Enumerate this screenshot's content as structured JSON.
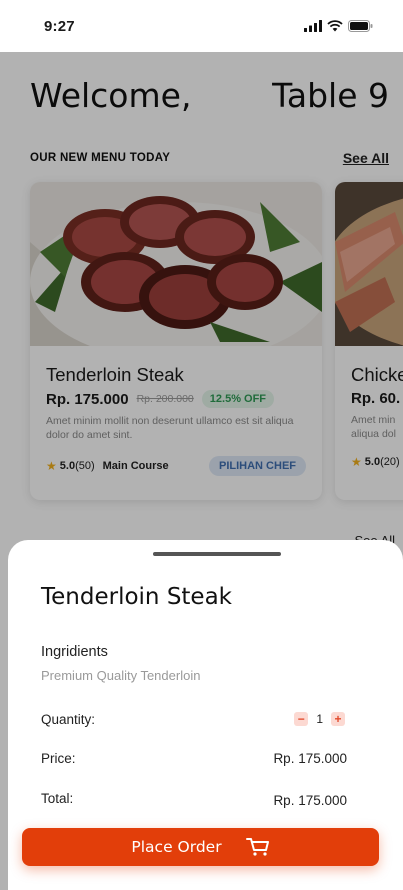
{
  "status_bar": {
    "time": "9:27",
    "icons": [
      "signal-icon",
      "wifi-icon",
      "battery-icon"
    ]
  },
  "header": {
    "welcome": "Welcome,",
    "table": "Table 9"
  },
  "section": {
    "title": "OUR NEW MENU TODAY",
    "see_all": "See  All"
  },
  "cards": [
    {
      "name": "Tenderloin Steak",
      "price": "Rp. 175.000",
      "old_price": "Rp. 200.000",
      "discount": "12.5% OFF",
      "description": "Amet minim mollit non deserunt ullamco est sit aliqua dolor do amet sint.",
      "rating": "5.0",
      "rating_count": "(50)",
      "category": "Main Course",
      "badge": "PILIHAN CHEF"
    },
    {
      "name": "Chicke",
      "price": "Rp. 60.",
      "description": "Amet min aliqua dol",
      "rating": "5.0",
      "rating_count": "(20)"
    }
  ],
  "second_see_all": "See  All",
  "sheet": {
    "title": "Tenderloin Steak",
    "ingredients_label": "Ingridients",
    "ingredients_value": "Premium Quality Tenderloin",
    "quantity_label": "Quantity:",
    "quantity": "1",
    "price_label": "Price:",
    "price_value": "Rp. 175.000",
    "total_label": "Total:",
    "total_value": "Rp. 175.000",
    "order_button": "Place Order"
  },
  "colors": {
    "accent": "#e23e0a",
    "discount": "#2e9b55",
    "chef_badge": "#3f6fb0",
    "star": "#f2b01e"
  }
}
